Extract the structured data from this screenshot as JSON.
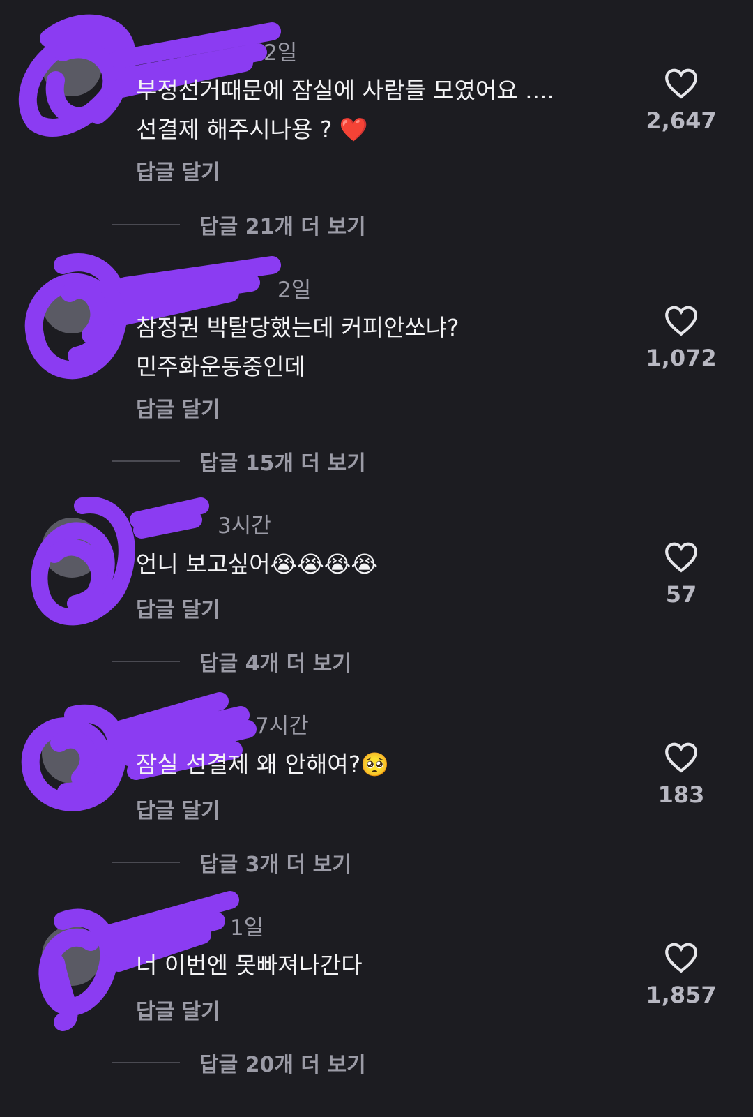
{
  "comments": [
    {
      "time": "2일",
      "text": "부정선거때문에 잠실에 사람들 모였어요 ....\n선결제 해주시나용 ? ❤️",
      "reply_label": "답글 달기",
      "likes": "2,647",
      "more_replies": "답글 21개 더 보기"
    },
    {
      "time": "2일",
      "text": "참정권 박탈당했는데 커피안쏘냐?\n민주화운동중인데",
      "reply_label": "답글 달기",
      "likes": "1,072",
      "more_replies": "답글 15개 더 보기"
    },
    {
      "time": "3시간",
      "text": "언니 보고싶어😭😭😭😭",
      "reply_label": "답글 달기",
      "likes": "57",
      "more_replies": "답글 4개 더 보기"
    },
    {
      "time": "7시간",
      "text": "잠실 선결제 왜 안해여?🥺",
      "reply_label": "답글 달기",
      "likes": "183",
      "more_replies": "답글 3개 더 보기"
    },
    {
      "time": "1일",
      "text": "너 이번엔 못빠져나간다",
      "reply_label": "답글 달기",
      "likes": "1,857",
      "more_replies": "답글 20개 더 보기"
    }
  ],
  "colors": {
    "background": "#1c1c21",
    "redaction": "#8b3cf2",
    "secondary_text": "#9b9ba6"
  }
}
